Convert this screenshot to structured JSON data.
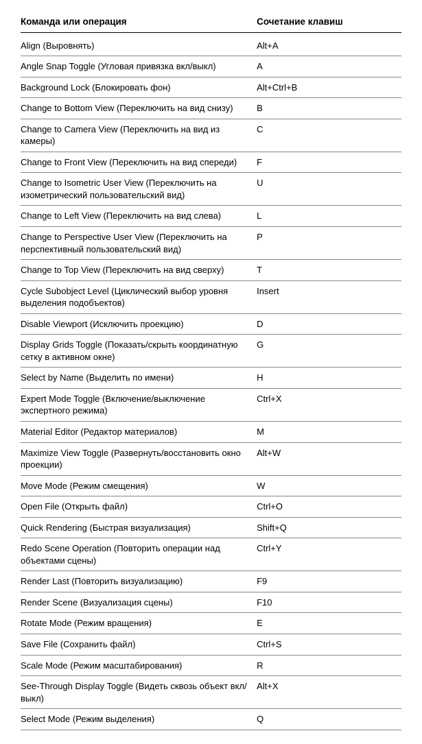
{
  "table": {
    "headers": {
      "command": "Команда или операция",
      "shortcut": "Сочетание клавиш"
    },
    "rows": [
      {
        "command": "Align (Выровнять)",
        "shortcut": "Alt+A"
      },
      {
        "command": "Angle Snap Toggle (Угловая привязка вкл/выкл)",
        "shortcut": "A"
      },
      {
        "command": "Background Lock (Блокировать фон)",
        "shortcut": "Alt+Ctrl+B"
      },
      {
        "command": "Change to Bottom View (Переключить на вид снизу)",
        "shortcut": "B"
      },
      {
        "command": "Change to Camera View (Переключить на вид из камеры)",
        "shortcut": "C"
      },
      {
        "command": "Change to Front View (Переключить на вид спереди)",
        "shortcut": "F"
      },
      {
        "command": "Change to Isometric User View\n(Переключить на изометрический пользовательский вид)",
        "shortcut": "U"
      },
      {
        "command": "Change to Left View (Переключить на вид слева)",
        "shortcut": "L"
      },
      {
        "command": "Change to Perspective User View\n(Переключить на перспективный пользовательский вид)",
        "shortcut": "P"
      },
      {
        "command": "Change to Top View (Переключить на вид сверху)",
        "shortcut": "T"
      },
      {
        "command": "Cycle Subobject Level\n(Циклический выбор уровня выделения подобъектов)",
        "shortcut": "Insert"
      },
      {
        "command": "Disable Viewport (Исключить проекцию)",
        "shortcut": "D"
      },
      {
        "command": "Display Grids Toggle (Показать/скрыть координатную сетку в активном окне)",
        "shortcut": "G"
      },
      {
        "command": "Select by Name (Выделить по имени)",
        "shortcut": "H"
      },
      {
        "command": "Expert Mode Toggle\n(Включение/выключение экспертного режима)",
        "shortcut": "Ctrl+X"
      },
      {
        "command": "Material Editor (Редактор материалов)",
        "shortcut": "M"
      },
      {
        "command": "Maximize View Toggle\n(Развернуть/восстановить окно проекции)",
        "shortcut": "Alt+W"
      },
      {
        "command": "Move Mode (Режим смещения)",
        "shortcut": "W"
      },
      {
        "command": "Open File (Открыть файл)",
        "shortcut": "Ctrl+O"
      },
      {
        "command": "Quick Rendering (Быстрая визуализация)",
        "shortcut": "Shift+Q"
      },
      {
        "command": "Redo Scene Operation\n(Повторить операции над объектами сцены)",
        "shortcut": "Ctrl+Y"
      },
      {
        "command": "Render Last (Повторить визуализацию)",
        "shortcut": "F9"
      },
      {
        "command": "Render Scene (Визуализация сцены)",
        "shortcut": "F10"
      },
      {
        "command": "Rotate Mode (Режим вращения)",
        "shortcut": "E"
      },
      {
        "command": "Save File (Сохранить файл)",
        "shortcut": "Ctrl+S"
      },
      {
        "command": "Scale Mode (Режим масштабирования)",
        "shortcut": "R"
      },
      {
        "command": "See-Through Display Toggle\n(Видеть сквозь объект вкл/выкл)",
        "shortcut": "Alt+X"
      },
      {
        "command": "Select Mode (Режим выделения)",
        "shortcut": "Q"
      }
    ]
  }
}
